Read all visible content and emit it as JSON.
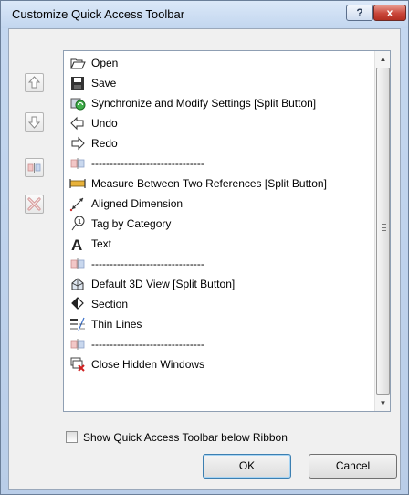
{
  "window": {
    "title": "Customize Quick Access Toolbar",
    "help_glyph": "?",
    "close_glyph": "x"
  },
  "side_buttons": [
    {
      "name": "move-up-button",
      "icon": "arrow-up-icon"
    },
    {
      "name": "move-down-button",
      "icon": "arrow-down-icon"
    },
    {
      "name": "add-separator-button",
      "icon": "separator-icon"
    },
    {
      "name": "remove-button",
      "icon": "delete-x-icon"
    }
  ],
  "list": {
    "items": [
      {
        "label": "Open",
        "icon": "folder-open-icon"
      },
      {
        "label": "Save",
        "icon": "floppy-disk-icon"
      },
      {
        "label": "Synchronize and Modify Settings [Split Button]",
        "icon": "synchronize-icon"
      },
      {
        "label": "Undo",
        "icon": "undo-arrow-icon"
      },
      {
        "label": "Redo",
        "icon": "redo-arrow-icon"
      },
      {
        "label": "-------------------------------",
        "icon": "separator-icon"
      },
      {
        "label": "Measure Between Two References [Split Button]",
        "icon": "measure-icon"
      },
      {
        "label": "Aligned Dimension",
        "icon": "aligned-dimension-icon"
      },
      {
        "label": "Tag by Category",
        "icon": "tag-icon"
      },
      {
        "label": "Text",
        "icon": "text-a-icon"
      },
      {
        "label": "-------------------------------",
        "icon": "separator-icon"
      },
      {
        "label": "Default 3D View [Split Button]",
        "icon": "3d-view-house-icon"
      },
      {
        "label": "Section",
        "icon": "section-icon"
      },
      {
        "label": "Thin Lines",
        "icon": "thin-lines-icon"
      },
      {
        "label": "-------------------------------",
        "icon": "separator-icon"
      },
      {
        "label": "Close Hidden Windows",
        "icon": "close-hidden-windows-icon"
      }
    ]
  },
  "scrollbar": {
    "up_glyph": "▲",
    "down_glyph": "▼"
  },
  "checkbox": {
    "label": "Show Quick Access Toolbar below Ribbon",
    "checked": false
  },
  "buttons": {
    "ok": "OK",
    "cancel": "Cancel"
  },
  "colors": {
    "title_bar": "#c2d6ef",
    "close_button": "#c9463a",
    "client": "#f0f0f0"
  }
}
